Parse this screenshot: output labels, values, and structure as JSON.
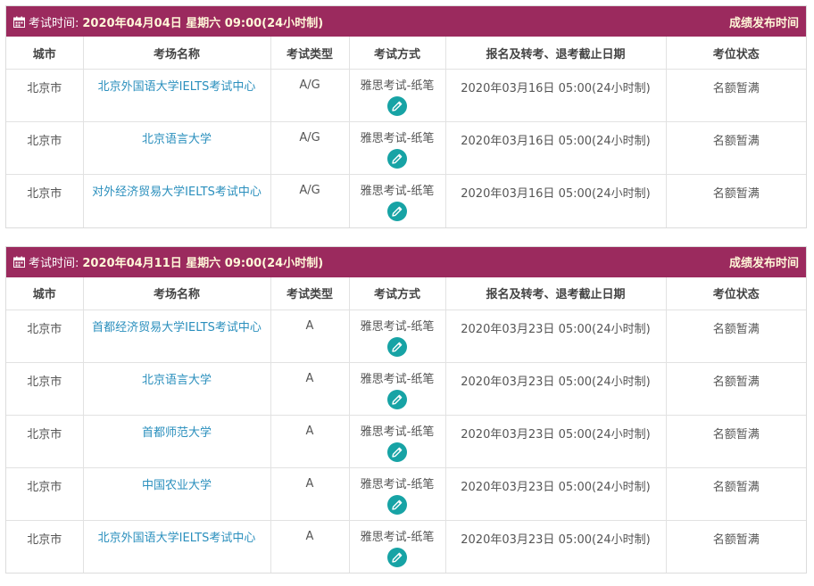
{
  "column_headers": [
    "城市",
    "考场名称",
    "考试类型",
    "考试方式",
    "报名及转考、退考截止日期",
    "考位状态"
  ],
  "sessions": [
    {
      "time_label": "考试时间:",
      "date": "2020年04月04日 星期六 09:00(24小时制)",
      "results_link": "成绩发布时间",
      "rows": [
        {
          "city": "北京市",
          "venue": "北京外国语大学IELTS考试中心",
          "type": "A/G",
          "method": "雅思考试-纸笔",
          "deadline": "2020年03月16日 05:00(24小时制)",
          "status": "名额暂满"
        },
        {
          "city": "北京市",
          "venue": "北京语言大学",
          "type": "A/G",
          "method": "雅思考试-纸笔",
          "deadline": "2020年03月16日 05:00(24小时制)",
          "status": "名额暂满"
        },
        {
          "city": "北京市",
          "venue": "对外经济贸易大学IELTS考试中心",
          "type": "A/G",
          "method": "雅思考试-纸笔",
          "deadline": "2020年03月16日 05:00(24小时制)",
          "status": "名额暂满"
        }
      ]
    },
    {
      "time_label": "考试时间:",
      "date": "2020年04月11日 星期六 09:00(24小时制)",
      "results_link": "成绩发布时间",
      "rows": [
        {
          "city": "北京市",
          "venue": "首都经济贸易大学IELTS考试中心",
          "type": "A",
          "method": "雅思考试-纸笔",
          "deadline": "2020年03月23日 05:00(24小时制)",
          "status": "名额暂满"
        },
        {
          "city": "北京市",
          "venue": "北京语言大学",
          "type": "A",
          "method": "雅思考试-纸笔",
          "deadline": "2020年03月23日 05:00(24小时制)",
          "status": "名额暂满"
        },
        {
          "city": "北京市",
          "venue": "首都师范大学",
          "type": "A",
          "method": "雅思考试-纸笔",
          "deadline": "2020年03月23日 05:00(24小时制)",
          "status": "名额暂满"
        },
        {
          "city": "北京市",
          "venue": "中国农业大学",
          "type": "A",
          "method": "雅思考试-纸笔",
          "deadline": "2020年03月23日 05:00(24小时制)",
          "status": "名额暂满"
        },
        {
          "city": "北京市",
          "venue": "北京外国语大学IELTS考试中心",
          "type": "A",
          "method": "雅思考试-纸笔",
          "deadline": "2020年03月23日 05:00(24小时制)",
          "status": "名额暂满"
        }
      ]
    }
  ],
  "icons": {
    "calendar": "calendar-icon",
    "edit": "pencil-icon"
  },
  "colors": {
    "header_bg": "#9b2a5e",
    "link": "#2a8fbd",
    "edit_button": "#17a3a5"
  }
}
